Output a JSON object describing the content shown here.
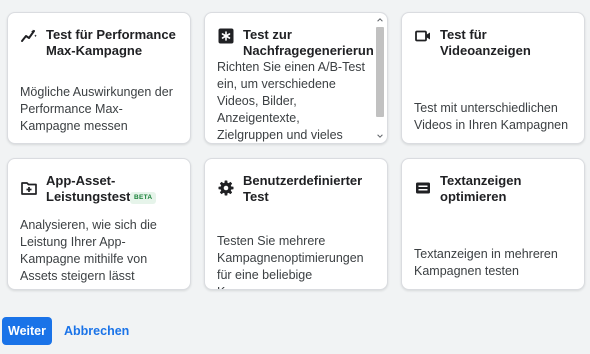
{
  "cards": [
    {
      "icon": "performance-max-icon",
      "title": "Test für Performance Max-Kampagne",
      "description": "Mögliche Auswirkungen der Performance Max-Kampagne messen"
    },
    {
      "icon": "asterisk-icon",
      "title": "Test zur Nachfragegenerierung",
      "description": "Richten Sie einen A/B-Test ein, um verschiedene Videos, Bilder, Anzeigentexte, Zielgruppen und vieles mehr zu vergleichen"
    },
    {
      "icon": "video-camera-icon",
      "title": "Test für Videoanzeigen",
      "description": "Test mit unterschiedlichen Videos in Ihren Kampagnen"
    },
    {
      "icon": "app-asset-icon",
      "title": "App-Asset-Leistungstest",
      "badge": "BETA",
      "description": "Analysieren, wie sich die Leistung Ihrer App-Kampagne mithilfe von Assets steigern lässt"
    },
    {
      "icon": "gear-icon",
      "title": "Benutzerdefinierter Test",
      "description": "Testen Sie mehrere Kampagnenoptimierungen für eine beliebige Kampagne"
    },
    {
      "icon": "text-ad-icon",
      "title": "Textanzeigen optimieren",
      "description": "Textanzeigen in mehreren Kampagnen testen"
    }
  ],
  "footer": {
    "continue_label": "Weiter",
    "cancel_label": "Abbrechen"
  },
  "colors": {
    "primary": "#1a73e8",
    "beta_text": "#188038",
    "beta_bg": "#e6f4ea"
  }
}
